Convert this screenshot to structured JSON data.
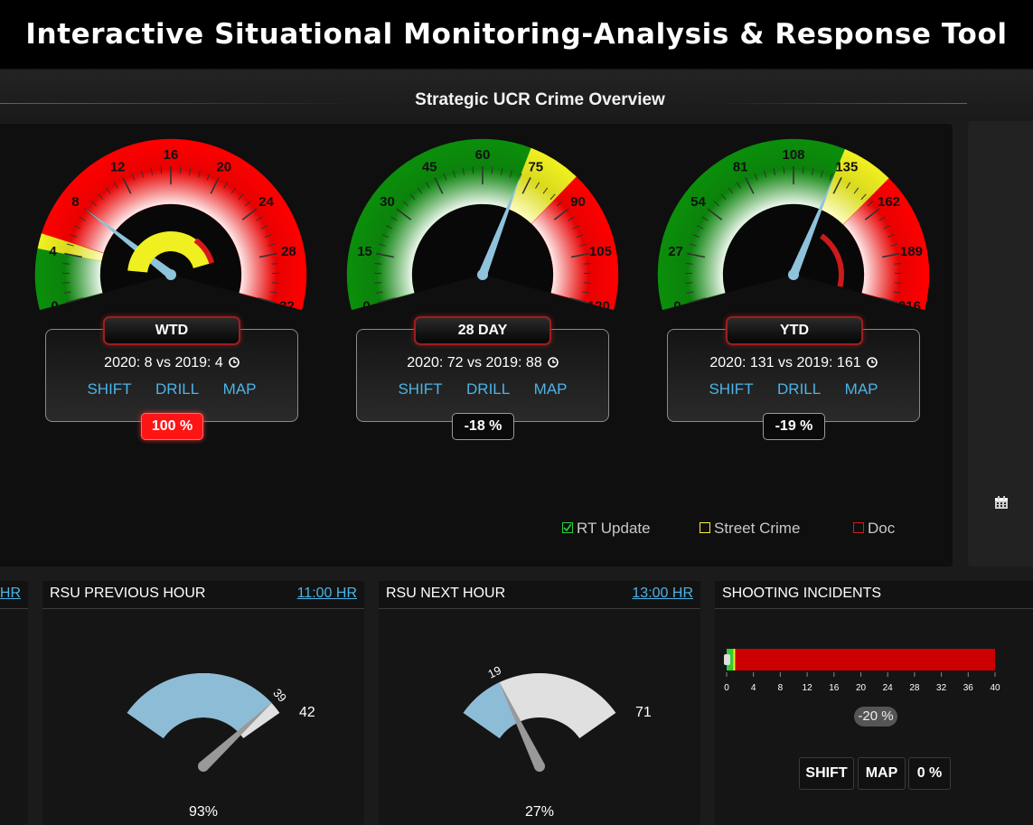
{
  "app": {
    "title": "Interactive Situational Monitoring-Analysis & Response Tool",
    "section_title": "Strategic UCR Crime Overview"
  },
  "gauges": [
    {
      "id": "wtd",
      "label": "WTD",
      "comparison": "2020: 8 vs 2019: 4",
      "links": [
        "SHIFT",
        "DRILL",
        "MAP"
      ],
      "percent": "100 %",
      "percent_style": "red",
      "min": 0,
      "max": 32,
      "value": 8,
      "prior": 4,
      "ticks": [
        "0",
        "4",
        "8",
        "12",
        "16",
        "20",
        "24",
        "28",
        "32"
      ],
      "zones": [
        {
          "from": 0,
          "to": 4,
          "color": "green"
        },
        {
          "from": 4,
          "to": 5,
          "color": "yellow"
        },
        {
          "from": 5,
          "to": 32,
          "color": "red"
        }
      ]
    },
    {
      "id": "28day",
      "label": "28 DAY",
      "comparison": "2020: 72 vs 2019: 88",
      "links": [
        "SHIFT",
        "DRILL",
        "MAP"
      ],
      "percent": "-18 %",
      "percent_style": "dark",
      "min": 0,
      "max": 120,
      "value": 72,
      "prior": 88,
      "ticks": [
        "0",
        "15",
        "30",
        "45",
        "60",
        "75",
        "90",
        "105",
        "120"
      ],
      "zones": [
        {
          "from": 0,
          "to": 72,
          "color": "green"
        },
        {
          "from": 72,
          "to": 85,
          "color": "yellow"
        },
        {
          "from": 85,
          "to": 120,
          "color": "red"
        }
      ]
    },
    {
      "id": "ytd",
      "label": "YTD",
      "comparison": "2020: 131 vs 2019: 161",
      "links": [
        "SHIFT",
        "DRILL",
        "MAP"
      ],
      "percent": "-19 %",
      "percent_style": "dark",
      "min": 0,
      "max": 216,
      "value": 131,
      "prior": 161,
      "ticks": [
        "0",
        "27",
        "54",
        "81",
        "108",
        "135",
        "162",
        "189",
        "216"
      ],
      "zones": [
        {
          "from": 0,
          "to": 131,
          "color": "green"
        },
        {
          "from": 131,
          "to": 154,
          "color": "yellow"
        },
        {
          "from": 154,
          "to": 216,
          "color": "red"
        }
      ]
    }
  ],
  "legend": [
    {
      "label": "RT Update",
      "color": "#2ecc40",
      "checked": true
    },
    {
      "label": "Street Crime",
      "color": "#f7f13a",
      "checked": false
    },
    {
      "label": "Doc",
      "color": "#d81818",
      "checked": false
    }
  ],
  "cards": {
    "partial": {
      "link": "HR"
    },
    "rsu_prev": {
      "title": "RSU PREVIOUS HOUR",
      "link": "11:00 HR",
      "value": 39,
      "max": 42,
      "value_label": "39",
      "max_label": "42",
      "percent": "93%"
    },
    "rsu_next": {
      "title": "RSU NEXT HOUR",
      "link": "13:00 HR",
      "value": 19,
      "max": 71,
      "value_label": "19",
      "max_label": "71",
      "percent": "27%"
    },
    "shooting": {
      "title": "SHOOTING INCIDENTS",
      "axis": [
        "0",
        "4",
        "8",
        "12",
        "16",
        "20",
        "24",
        "28",
        "32",
        "36",
        "40"
      ],
      "value": 1,
      "bar_max": 40,
      "badge": "-20 %",
      "buttons": [
        "SHIFT",
        "MAP",
        "0 %"
      ]
    }
  }
}
